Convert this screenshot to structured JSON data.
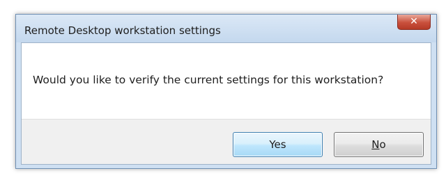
{
  "dialog": {
    "title": "Remote Desktop workstation settings",
    "close_icon": "close-icon",
    "message": "Would you like to verify the current settings for this workstation?",
    "buttons": {
      "yes_label": "Yes",
      "no_label": "No"
    }
  },
  "colors": {
    "titlebar": "#c4d8ee",
    "close_button": "#c9503c",
    "default_button_border": "#3c7fb1",
    "footer": "#f0f0f0"
  }
}
